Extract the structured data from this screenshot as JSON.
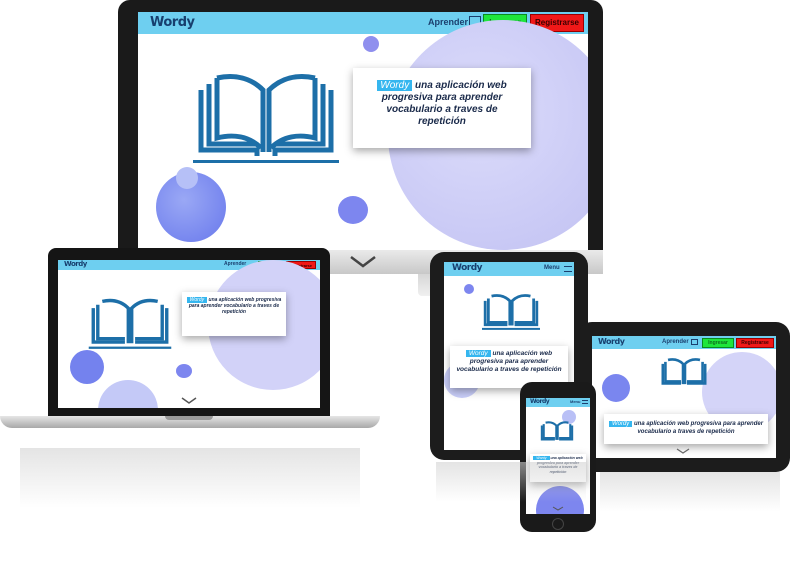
{
  "app": {
    "logo": "Wordy",
    "nav": {
      "aprender_label": "Aprender",
      "menu_label": "Menu",
      "ingresar_label": "Ingresar",
      "registrarse_label": "Registrarse"
    },
    "hero": {
      "badge": "Wordy",
      "tagline_desktop": "una aplicación web progresiva para aprender vocabulario a traves de repetición",
      "tagline_laptop": "una aplicación web progresiva para aprender vocabulario a traves de repetición",
      "tagline_tablet": "una aplicación web progresiva para aprender vocabulario a traves de repetición",
      "tagline_landscape": "una aplicación web progresiva para aprender vocabulario a traves de repetición",
      "tagline_phone": "una aplicación web progresiva para aprender vocabulario a traves de repetición"
    }
  },
  "devices": [
    "desktop-monitor",
    "laptop",
    "tablet-portrait",
    "tablet-landscape",
    "phone"
  ],
  "icons": {
    "book": "open-book-icon",
    "learn": "cards-icon",
    "menu": "hamburger-icon",
    "scroll": "chevron-down-icon"
  },
  "colors": {
    "nav_bg": "#6ecff0",
    "accent": "#35b6ef",
    "book_blue": "#1d6fa8",
    "ingresar": "#1ee63c",
    "registrarse": "#f01818",
    "blob": "#c9c9f5",
    "blob_dark": "#6f7fef"
  }
}
